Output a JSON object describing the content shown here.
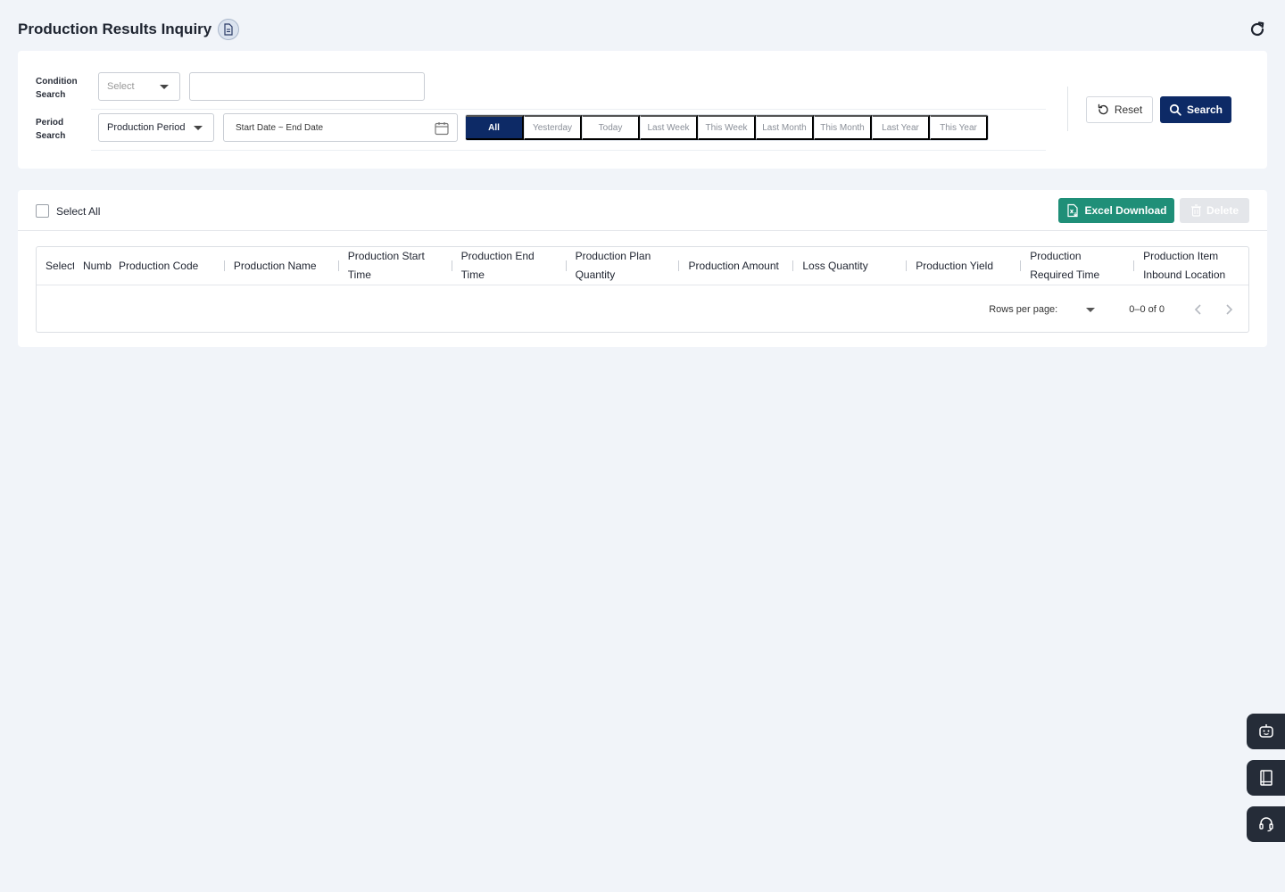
{
  "header": {
    "title": "Production Results Inquiry"
  },
  "search": {
    "condition_label_1": "Condition",
    "condition_label_2": "Search",
    "condition_select": "Select",
    "condition_input_value": "",
    "period_label_1": "Period",
    "period_label_2": "Search",
    "period_select": "Production Period",
    "date_range": "Start Date ~ End Date",
    "periods": [
      "All",
      "Yesterday",
      "Today",
      "Last Week",
      "This Week",
      "Last Month",
      "This Month",
      "Last Year",
      "This Year"
    ],
    "active_period": "All",
    "reset_label": "Reset",
    "search_label": "Search"
  },
  "grid": {
    "select_all_label": "Select All",
    "excel_label": "Excel Download",
    "delete_label": "Delete",
    "columns": [
      "Select",
      "Numb",
      "Production Code",
      "Production Name",
      "Production Start Time",
      "Production End Time",
      "Production Plan Quantity",
      "Production Amount",
      "Loss Quantity",
      "Production Yield",
      "Production Required Time",
      "Production Item Inbound Location"
    ],
    "rows_per_page_label": "Rows per page:",
    "page_info": "0–0 of 0"
  },
  "colors": {
    "primary": "#0d2a66",
    "excel": "#1f8f78",
    "background": "#f1f4f9"
  },
  "icons": [
    "document-icon",
    "refresh-icon",
    "calendar-icon",
    "reset-icon",
    "search-icon",
    "excel-icon",
    "trash-icon",
    "chatbot-icon",
    "manual-book-icon",
    "headset-icon"
  ]
}
